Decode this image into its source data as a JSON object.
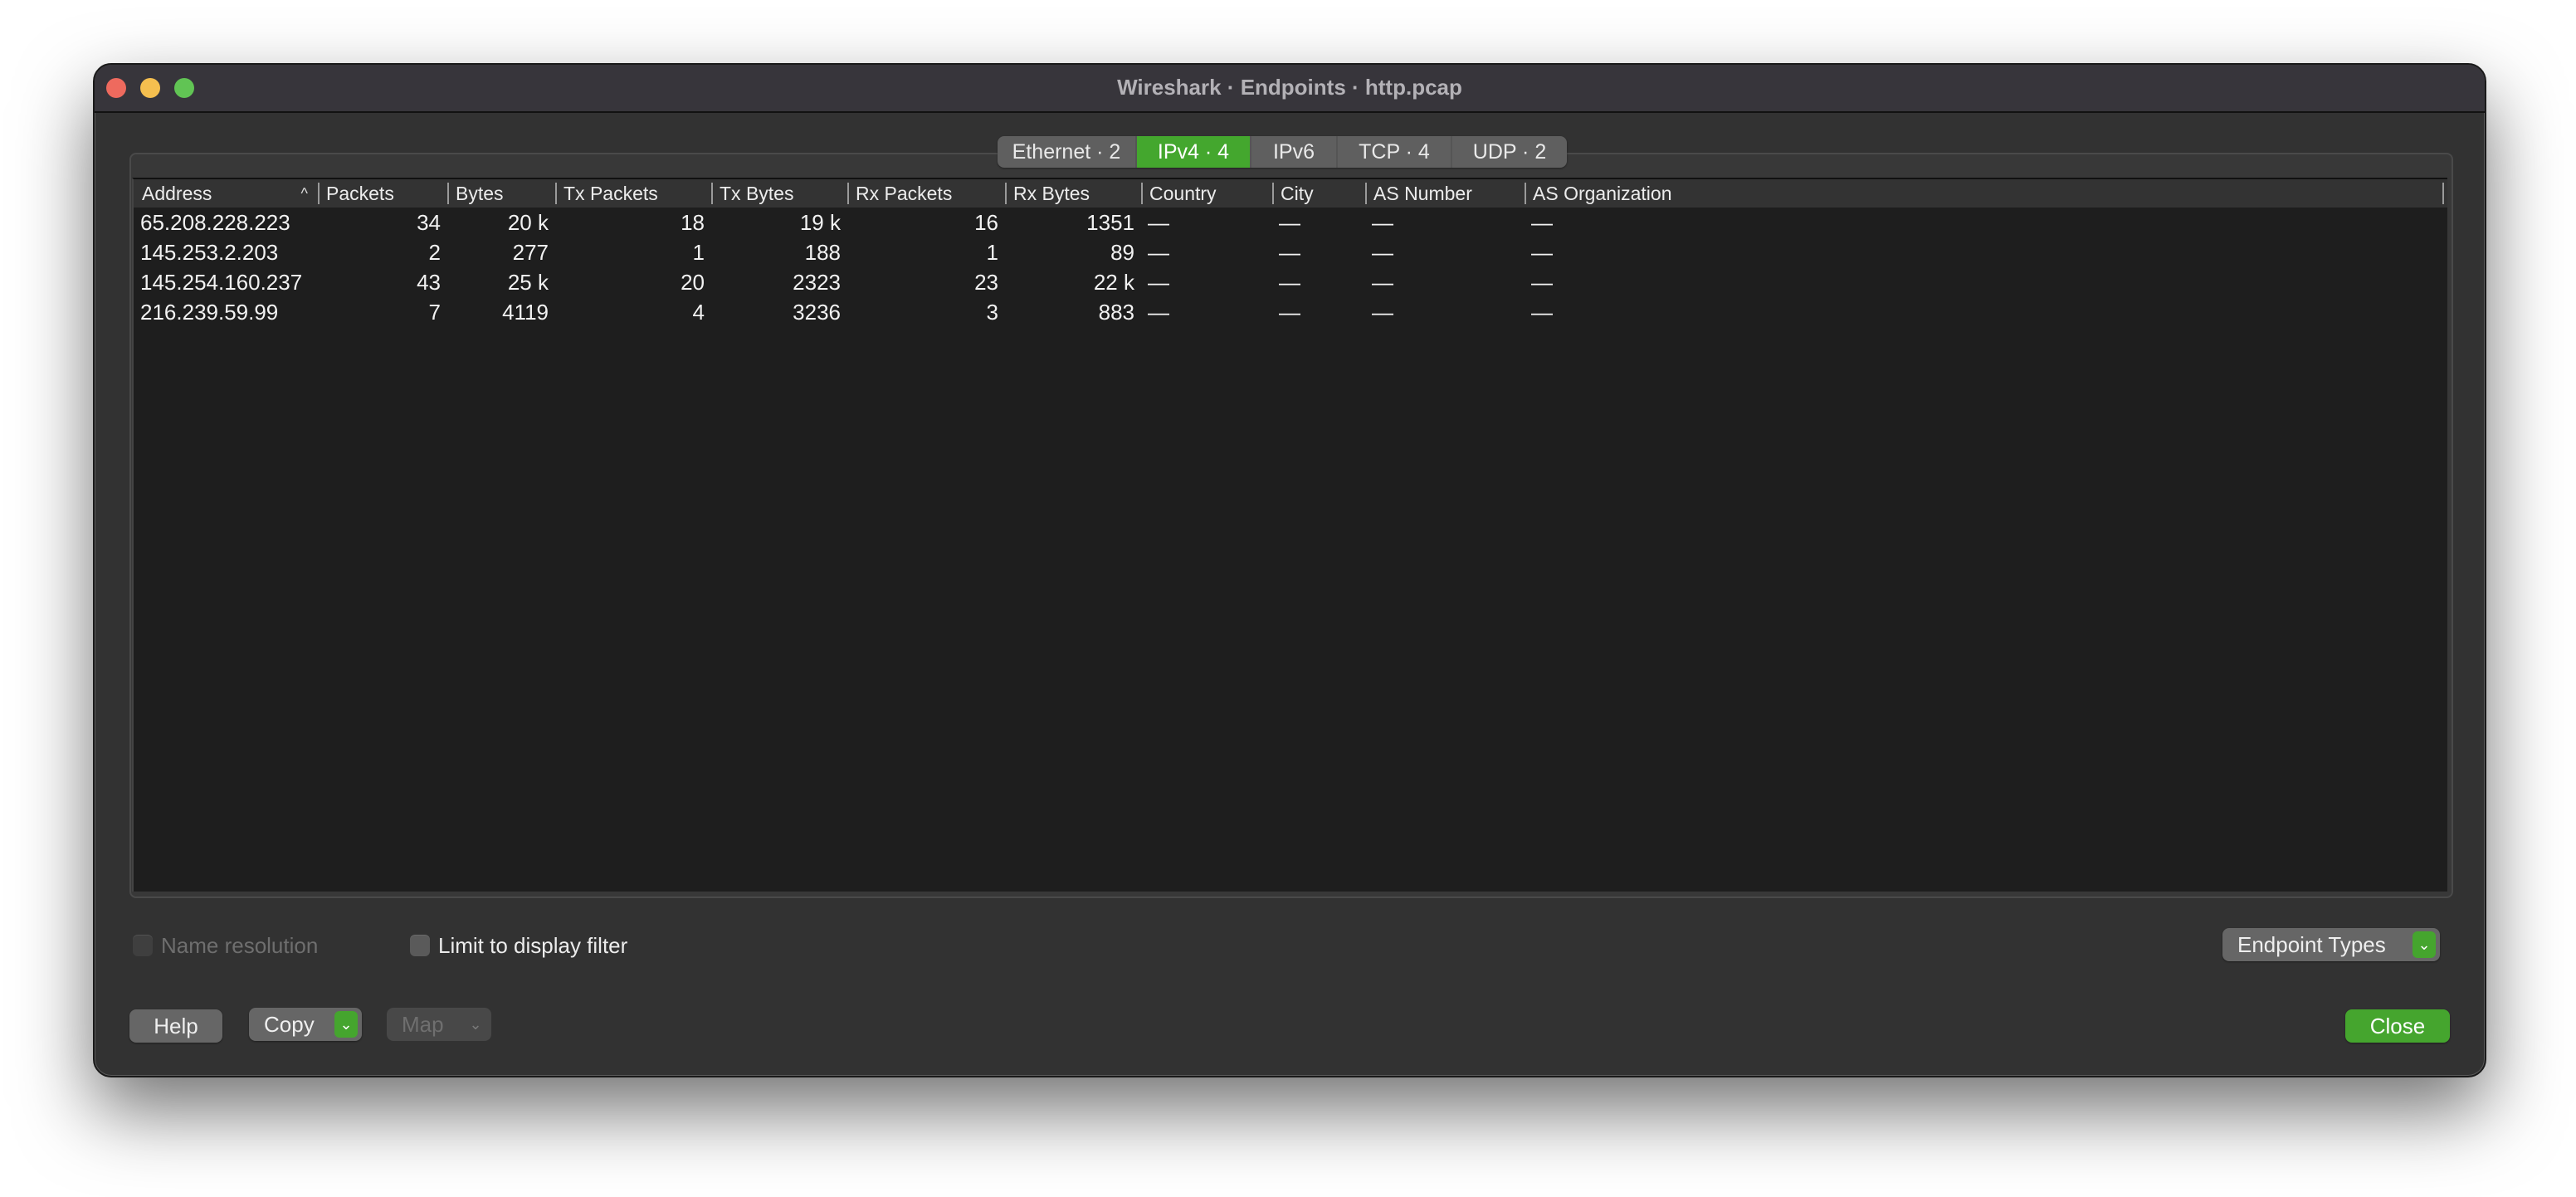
{
  "window": {
    "title": "Wireshark · Endpoints · http.pcap"
  },
  "tabs": [
    {
      "label": "Ethernet · 2",
      "active": false
    },
    {
      "label": "IPv4 · 4",
      "active": true
    },
    {
      "label": "IPv6",
      "active": false
    },
    {
      "label": "TCP · 4",
      "active": false
    },
    {
      "label": "UDP · 2",
      "active": false
    }
  ],
  "table": {
    "sort_indicator": "^",
    "columns": [
      "Address",
      "Packets",
      "Bytes",
      "Tx Packets",
      "Tx Bytes",
      "Rx Packets",
      "Rx Bytes",
      "Country",
      "City",
      "AS Number",
      "AS Organization"
    ],
    "rows": [
      [
        "65.208.228.223",
        "34",
        "20 k",
        "18",
        "19 k",
        "16",
        "1351",
        "—",
        "—",
        "—",
        "—"
      ],
      [
        "145.253.2.203",
        "2",
        "277",
        "1",
        "188",
        "1",
        "89",
        "—",
        "—",
        "—",
        "—"
      ],
      [
        "145.254.160.237",
        "43",
        "25 k",
        "20",
        "2323",
        "23",
        "22 k",
        "—",
        "—",
        "—",
        "—"
      ],
      [
        "216.239.59.99",
        "7",
        "4119",
        "4",
        "3236",
        "3",
        "883",
        "—",
        "—",
        "—",
        "—"
      ]
    ]
  },
  "options": {
    "name_resolution": {
      "label": "Name resolution",
      "checked": false,
      "enabled": false
    },
    "limit_filter": {
      "label": "Limit to display filter",
      "checked": false,
      "enabled": true
    }
  },
  "buttons": {
    "endpoint_types": "Endpoint Types",
    "help": "Help",
    "copy": "Copy",
    "map": "Map",
    "close": "Close",
    "chevron": "⌄"
  },
  "colors": {
    "accent_green": "#45a52e",
    "window_bg": "#323232",
    "table_bg": "#1e1e1e"
  }
}
